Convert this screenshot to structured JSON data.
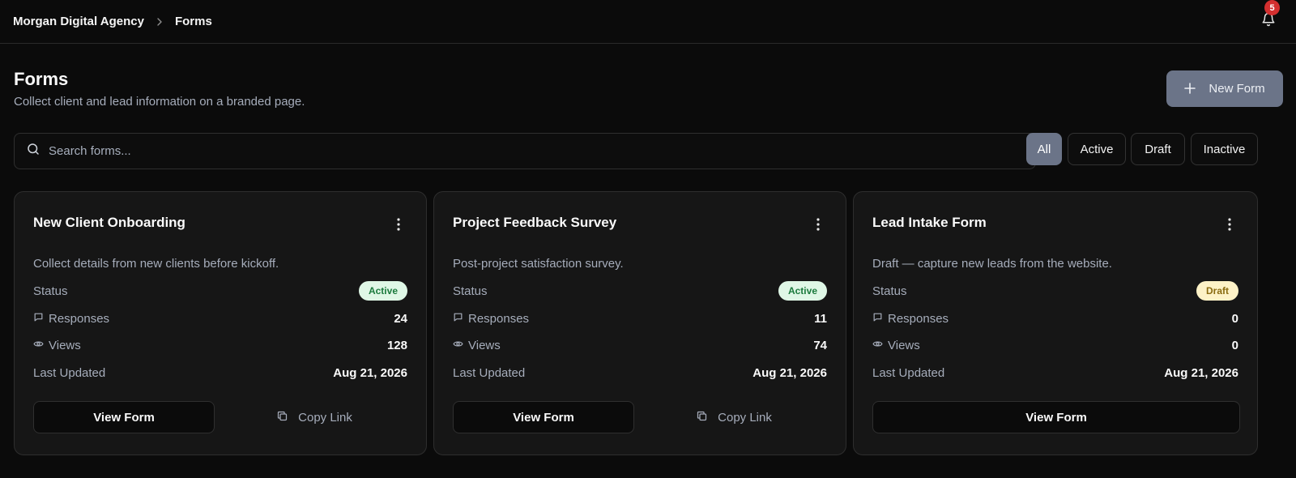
{
  "breadcrumb": {
    "workspace": "Morgan Digital Agency",
    "current": "Forms"
  },
  "notifications": {
    "count": "5"
  },
  "header": {
    "title": "Forms",
    "subtitle": "Collect client and lead information on a branded page.",
    "new_form_label": "New Form"
  },
  "search": {
    "placeholder": "Search forms..."
  },
  "filters": [
    "All",
    "Active",
    "Draft",
    "Inactive"
  ],
  "labels": {
    "status": "Status",
    "responses": "Responses",
    "views": "Views",
    "last_updated": "Last Updated",
    "view_form": "View Form",
    "copy_link": "Copy Link"
  },
  "cards": [
    {
      "title": "New Client Onboarding",
      "description": "Collect details from new clients before kickoff.",
      "status": "Active",
      "responses": "24",
      "views": "128",
      "last_updated": "Aug 21, 2026"
    },
    {
      "title": "Project Feedback Survey",
      "description": "Post-project satisfaction survey.",
      "status": "Active",
      "responses": "11",
      "views": "74",
      "last_updated": "Aug 21, 2026"
    },
    {
      "title": "Lead Intake Form",
      "description": "Draft — capture new leads from the website.",
      "status": "Draft",
      "responses": "0",
      "views": "0",
      "last_updated": "Aug 21, 2026"
    }
  ]
}
